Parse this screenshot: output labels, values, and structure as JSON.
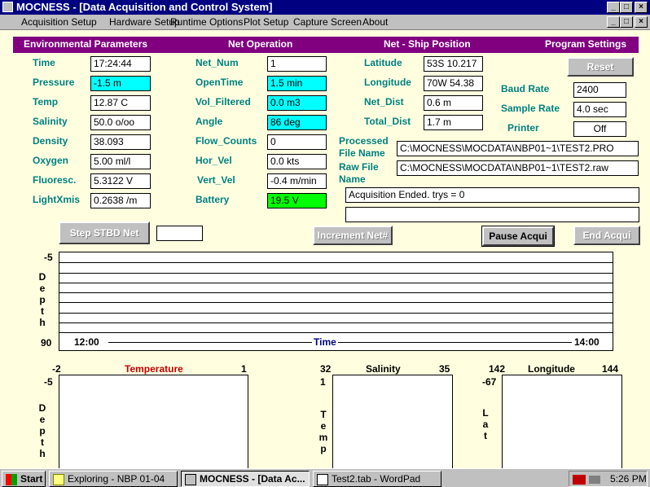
{
  "window": {
    "title": "MOCNESS - [Data Acquisition and Control System]"
  },
  "menu": [
    "Acquisition Setup",
    "Hardware Setup",
    "Runtime Options",
    "Plot Setup",
    "Capture Screen",
    "About"
  ],
  "sections": {
    "environmental": "Environmental Parameters",
    "net_operation": "Net Operation",
    "ship_position": "Net - Ship Position",
    "program_settings": "Program Settings"
  },
  "environmental": [
    {
      "label": "Time",
      "value": "17:24:44",
      "style": "white"
    },
    {
      "label": "Pressure",
      "value": "-1.5 m",
      "style": "cyan"
    },
    {
      "label": "Temp",
      "value": "12.87 C",
      "style": "white"
    },
    {
      "label": "Salinity",
      "value": "50.0 o/oo",
      "style": "white"
    },
    {
      "label": "Density",
      "value": "38.093",
      "style": "white"
    },
    {
      "label": "Oxygen",
      "value": "5.00 ml/l",
      "style": "white"
    },
    {
      "label": "Fluoresc.",
      "value": "5.3122 V",
      "style": "white"
    },
    {
      "label": "LightXmis",
      "value": "0.2638 /m",
      "style": "white"
    }
  ],
  "net_operation": [
    {
      "label": "Net_Num",
      "value": "1",
      "style": "white"
    },
    {
      "label": "OpenTime",
      "value": "1.5 min",
      "style": "cyan"
    },
    {
      "label": "Vol_Filtered",
      "value": "0.0 m3",
      "style": "cyan"
    },
    {
      "label": "Angle",
      "value": "86 deg",
      "style": "cyan"
    },
    {
      "label": "Flow_Counts",
      "value": "0",
      "style": "white"
    },
    {
      "label": "Hor_Vel",
      "value": "0.0 kts",
      "style": "white"
    },
    {
      "label": "Vert_Vel",
      "value": "-0.4 m/min",
      "style": "white"
    },
    {
      "label": "Battery",
      "value": "19.5 V",
      "style": "green"
    }
  ],
  "ship_position": [
    {
      "label": "Latitude",
      "value": "53S 10.217"
    },
    {
      "label": "Longitude",
      "value": "70W 54.38"
    },
    {
      "label": "Net_Dist",
      "value": "0.6 m"
    },
    {
      "label": "Total_Dist",
      "value": "1.7 m"
    }
  ],
  "program_settings": {
    "reset": "Reset",
    "baud_label": "Baud Rate",
    "baud_value": "2400",
    "sample_label": "Sample Rate",
    "sample_value": "4.0 sec",
    "printer_label": "Printer",
    "printer_value": "Off"
  },
  "files": {
    "processed_label_1": "Processed",
    "processed_label_2": "File Name",
    "processed_value": "C:\\MOCNESS\\MOCDATA\\NBP01~1\\TEST2.PRO",
    "raw_label_1": "Raw File",
    "raw_label_2": "Name",
    "raw_value": "C:\\MOCNESS\\MOCDATA\\NBP01~1\\TEST2.raw"
  },
  "status": {
    "line1": "Acquisition Ended. trys = 0",
    "line2": ""
  },
  "buttons": {
    "step": "Step STBD Net",
    "step_value": "",
    "increment": "Increment Net#",
    "pause": "Pause Acqui",
    "end": "End Acqui"
  },
  "depth_plot": {
    "ytop": "-5",
    "ybottom": "90",
    "ylabel": [
      "D",
      "e",
      "p",
      "t",
      "h"
    ],
    "xstart": "12:00",
    "xend": "14:00",
    "xlabel": "Time"
  },
  "profiles": [
    {
      "xmin": "-2",
      "xmax": "1",
      "title": "Temperature",
      "title_color": "#c00000",
      "ytop": "-5",
      "ylabel": [
        "D",
        "e",
        "p",
        "t",
        "h"
      ]
    },
    {
      "xmin": "32",
      "xmax": "35",
      "title": "Salinity",
      "title_color": "#000000",
      "ytop": "1",
      "ylabel": [
        "T",
        "e",
        "m",
        "p"
      ]
    },
    {
      "xmin": "142",
      "xmax": "144",
      "title": "Longitude",
      "title_color": "#000000",
      "ytop": "-67",
      "ylabel": [
        "L",
        "a",
        "t"
      ]
    }
  ],
  "taskbar": {
    "start": "Start",
    "items": [
      "Exploring - NBP 01-04",
      "MOCNESS - [Data Ac...",
      "Test2.tab - WordPad"
    ],
    "clock": "5:26 PM"
  }
}
